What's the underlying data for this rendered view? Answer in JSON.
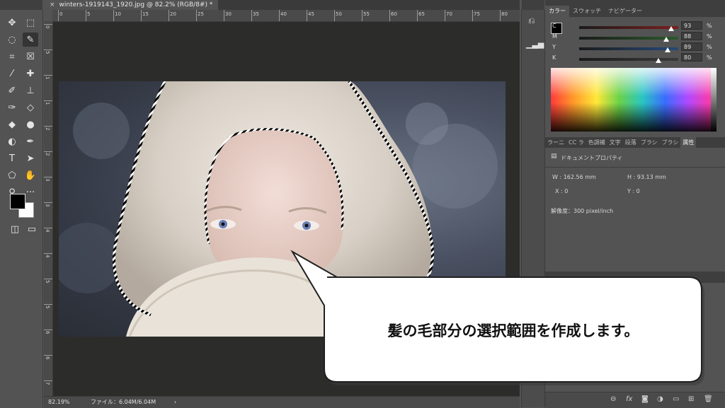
{
  "document": {
    "tab_close": "×",
    "tab_title": "winters-1919143_1920.jpg @ 82.2% (RGB/8#) *"
  },
  "rulers": {
    "top": [
      "0",
      "5",
      "10",
      "15",
      "20",
      "25",
      "30",
      "35",
      "40",
      "45",
      "50",
      "55",
      "60",
      "65",
      "70",
      "75",
      "80"
    ],
    "left": [
      "0",
      "5",
      "1",
      "1",
      "2",
      "2",
      "3",
      "3",
      "4",
      "4",
      "5",
      "5",
      "6",
      "6",
      "7"
    ]
  },
  "status": {
    "zoom": "82.19%",
    "file_info": "ファイル：6.04M/6.04M",
    "arrow": "›"
  },
  "tools": [
    {
      "name": "move-tool-icon",
      "glyph": "✥"
    },
    {
      "name": "marquee-tool-icon",
      "glyph": "⬚"
    },
    {
      "name": "lasso-tool-icon",
      "glyph": "◌"
    },
    {
      "name": "quick-selection-tool-icon",
      "glyph": "✎"
    },
    {
      "name": "crop-tool-icon",
      "glyph": "⌗"
    },
    {
      "name": "frame-tool-icon",
      "glyph": "☒"
    },
    {
      "name": "eyedropper-tool-icon",
      "glyph": "⁄"
    },
    {
      "name": "healing-brush-tool-icon",
      "glyph": "✚"
    },
    {
      "name": "brush-tool-icon",
      "glyph": "✐"
    },
    {
      "name": "stamp-tool-icon",
      "glyph": "⊥"
    },
    {
      "name": "history-brush-tool-icon",
      "glyph": "✑"
    },
    {
      "name": "eraser-tool-icon",
      "glyph": "◇"
    },
    {
      "name": "paint-bucket-tool-icon",
      "glyph": "◆"
    },
    {
      "name": "blur-tool-icon",
      "glyph": "●"
    },
    {
      "name": "dodge-tool-icon",
      "glyph": "◐"
    },
    {
      "name": "pen-tool-icon",
      "glyph": "✒"
    },
    {
      "name": "type-tool-icon",
      "glyph": "T"
    },
    {
      "name": "path-selection-tool-icon",
      "glyph": "➤"
    },
    {
      "name": "shape-tool-icon",
      "glyph": "⬠"
    },
    {
      "name": "hand-tool-icon",
      "glyph": "✋"
    },
    {
      "name": "zoom-tool-icon",
      "glyph": "⚲"
    },
    {
      "name": "more-tools-icon",
      "glyph": "···"
    }
  ],
  "color_panel": {
    "tabs": [
      "カラー",
      "スウォッチ",
      "ナビゲーター"
    ],
    "channels": [
      {
        "label": "C",
        "value": "93",
        "pct": "%",
        "pos": 0.93,
        "color": "#7a1f1f"
      },
      {
        "label": "M",
        "value": "88",
        "pct": "%",
        "pos": 0.88,
        "color": "#2a5a2a"
      },
      {
        "label": "Y",
        "value": "89",
        "pct": "%",
        "pos": 0.89,
        "color": "#264a7a"
      },
      {
        "label": "K",
        "value": "80",
        "pct": "%",
        "pos": 0.8,
        "color": "#3a3a3a"
      }
    ]
  },
  "props_panel": {
    "tabs": [
      "ラーニ",
      "CC ラ",
      "色調補",
      "文字",
      "段落",
      "ブラシ",
      "ブラシ",
      "属性"
    ],
    "section": "ドキュメントプロパティ",
    "w": "W : 162.56 mm",
    "h": "H : 93.13 mm",
    "x": "X : 0",
    "y": "Y : 0",
    "resolution": "解像度：300 pixel/inch"
  },
  "callout": {
    "text": "髪の毛部分の選択範囲を作成します。"
  }
}
